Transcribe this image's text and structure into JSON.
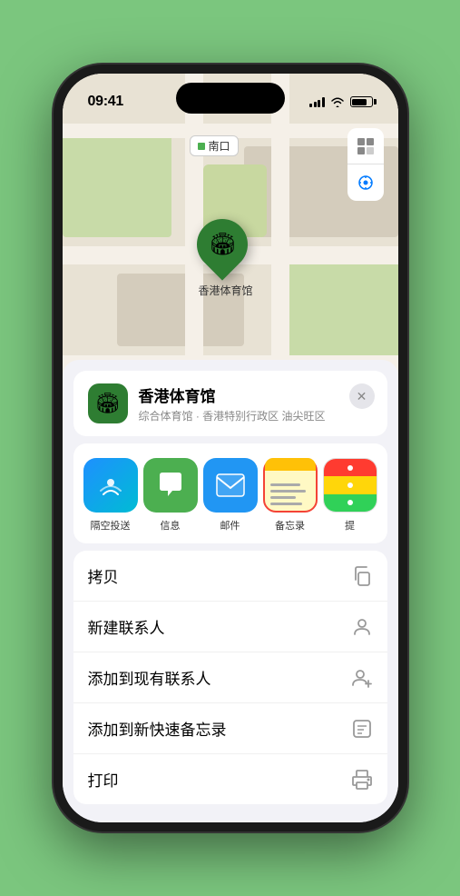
{
  "status_bar": {
    "time": "09:41",
    "location_arrow": "▶"
  },
  "map": {
    "label_text": "南口",
    "pin_label": "香港体育馆",
    "pin_emoji": "🏟"
  },
  "map_controls": {
    "map_btn_label": "🗺",
    "location_btn_label": "◎"
  },
  "location_card": {
    "icon_emoji": "🏟",
    "name": "香港体育馆",
    "subtitle": "综合体育馆 · 香港特别行政区 油尖旺区",
    "close_label": "✕"
  },
  "share_items": [
    {
      "id": "airdrop",
      "label": "隔空投送",
      "type": "airdrop"
    },
    {
      "id": "messages",
      "label": "信息",
      "type": "messages"
    },
    {
      "id": "mail",
      "label": "邮件",
      "type": "mail"
    },
    {
      "id": "notes",
      "label": "备忘录",
      "type": "notes"
    },
    {
      "id": "more",
      "label": "提",
      "type": "more"
    }
  ],
  "actions": [
    {
      "id": "copy",
      "label": "拷贝",
      "icon": "⧉"
    },
    {
      "id": "new-contact",
      "label": "新建联系人",
      "icon": "👤"
    },
    {
      "id": "add-existing",
      "label": "添加到现有联系人",
      "icon": "👤"
    },
    {
      "id": "add-notes",
      "label": "添加到新快速备忘录",
      "icon": "📋"
    },
    {
      "id": "print",
      "label": "打印",
      "icon": "🖨"
    }
  ]
}
